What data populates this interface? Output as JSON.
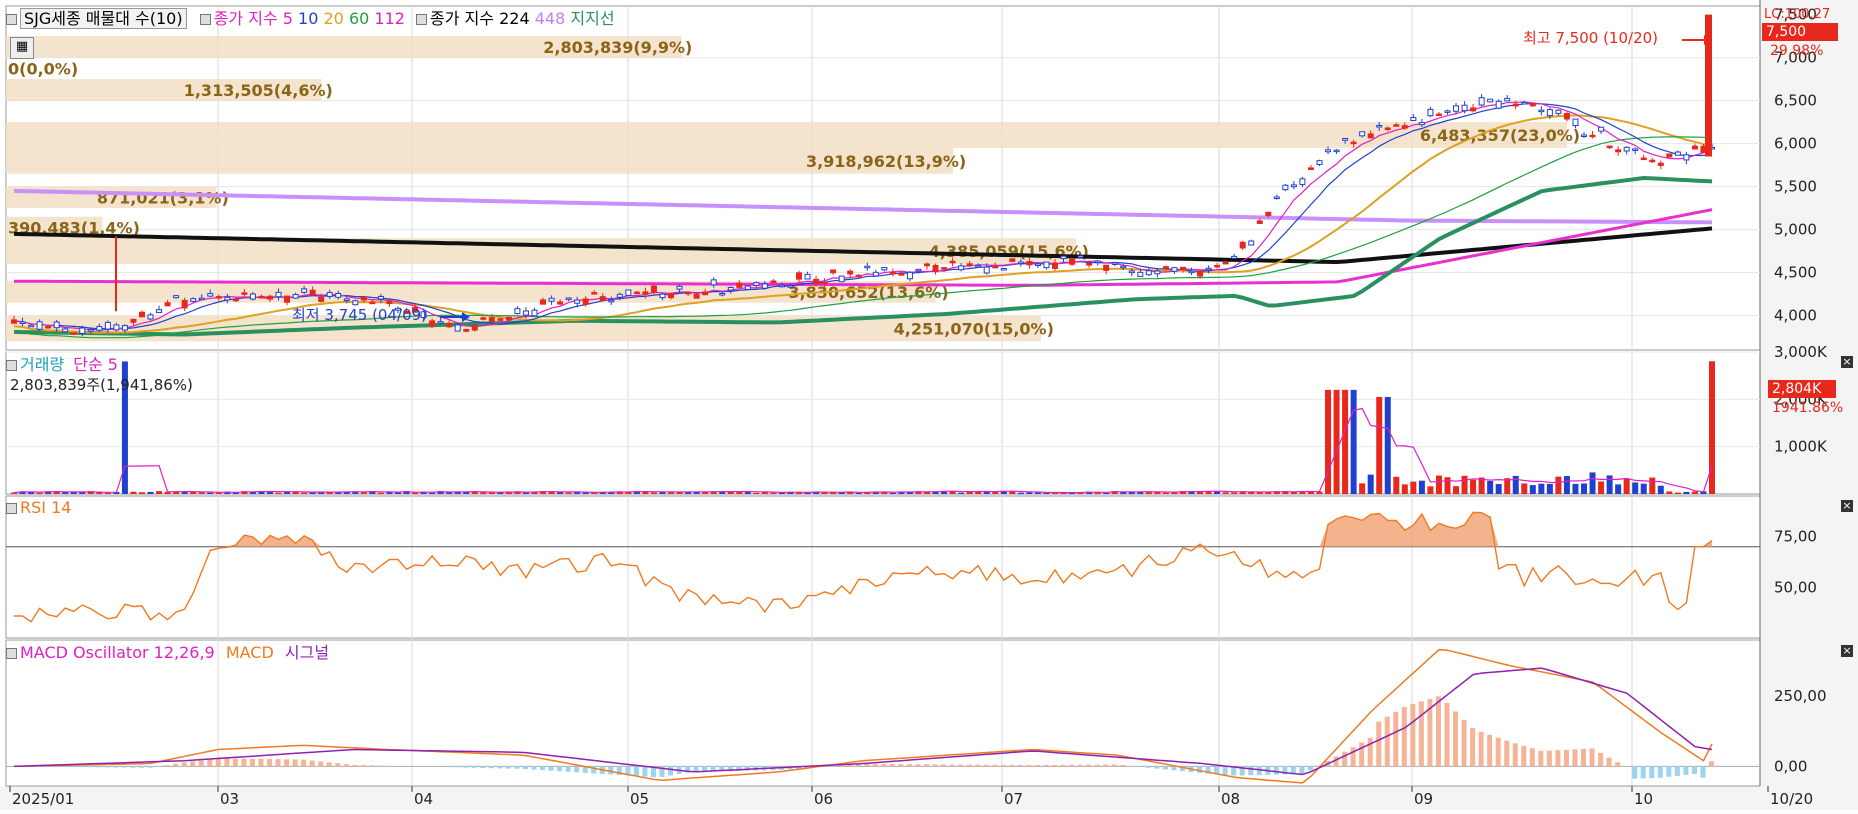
{
  "header": {
    "title_box": "SJG세종 매물대 수(10)",
    "ma_label": "종가 지수",
    "ma_periods": [
      "5",
      "10",
      "20",
      "60",
      "112"
    ],
    "long_label": "종가 지수 224",
    "long_448": "448",
    "support_label": "지지선"
  },
  "price_pane": {
    "highest_note": "최고 7,500 (10/20)",
    "lowest_note": "최저 3,745 (04/09)",
    "last_price": "7,500",
    "change_pct": "29.98%",
    "tag_fragment": "LC:100.27"
  },
  "volume_profile": [
    {
      "label": "2,803,839(9,9%)",
      "low": 7000,
      "high": 7250,
      "frac": 0.385
    },
    {
      "label": "0(0,0%)",
      "low": 6750,
      "high": 7000,
      "frac": 0.0
    },
    {
      "label": "1,313,505(4,6%)",
      "low": 6500,
      "high": 6750,
      "frac": 0.18
    },
    {
      "label": "6,483,357(23,0%)",
      "low": 5950,
      "high": 6250,
      "frac": 0.89
    },
    {
      "label": "3,918,962(13,9%)",
      "low": 5650,
      "high": 5950,
      "frac": 0.54
    },
    {
      "label": "871,021(3,1%)",
      "low": 5250,
      "high": 5500,
      "frac": 0.12
    },
    {
      "label": "390,483(1,4%)",
      "low": 4900,
      "high": 5150,
      "frac": 0.055
    },
    {
      "label": "4,385,059(15,6%)",
      "low": 4600,
      "high": 4900,
      "frac": 0.61
    },
    {
      "label": "3,830,652(13,6%)",
      "low": 4150,
      "high": 4400,
      "frac": 0.53
    },
    {
      "label": "4,251,070(15,0%)",
      "low": 3700,
      "high": 4000,
      "frac": 0.59
    }
  ],
  "chart_data": [
    {
      "type": "line",
      "pane": "price",
      "x": [
        "2025/01",
        "03",
        "04",
        "05",
        "06",
        "07",
        "08",
        "09",
        "10",
        "10/20"
      ],
      "ylim": [
        3600,
        7600
      ],
      "y_ticks": [
        "7,500",
        "7,000",
        "6,500",
        "6,000",
        "5,500",
        "5,000",
        "4,500",
        "4,000"
      ],
      "series": [
        {
          "name": "5",
          "color": "#e020c0"
        },
        {
          "name": "10",
          "color": "#2040d0"
        },
        {
          "name": "20",
          "color": "#e0a020"
        },
        {
          "name": "60",
          "color": "#20a040"
        },
        {
          "name": "112",
          "color": "#e020c0"
        },
        {
          "name": "224",
          "color": "#000000"
        },
        {
          "name": "448",
          "color": "#c080f0"
        },
        {
          "name": "지지선",
          "color": "#2a9060"
        }
      ],
      "high": 7500,
      "low": 3745,
      "close": 7500
    },
    {
      "type": "bar",
      "pane": "volume",
      "title": "거래량",
      "sma_label": "단순 5",
      "info": "2,803,839주(1,941,86%)",
      "y_ticks": [
        "3,000K",
        "2,000K",
        "1,000K"
      ],
      "ylim": [
        0,
        3000
      ],
      "last_value": "2,804K",
      "last_pct": "1941.86%"
    },
    {
      "type": "line",
      "pane": "rsi",
      "title": "RSI 14",
      "y_ticks": [
        "75,00",
        "50,00"
      ],
      "ylim": [
        25,
        95
      ],
      "threshold": 70
    },
    {
      "type": "line",
      "pane": "macd",
      "title": "MACD Oscillator 12,26,9",
      "series_labels": [
        "MACD",
        "시그널"
      ],
      "y_ticks": [
        "250,00",
        "0,00"
      ],
      "ylim": [
        -70,
        450
      ]
    }
  ]
}
